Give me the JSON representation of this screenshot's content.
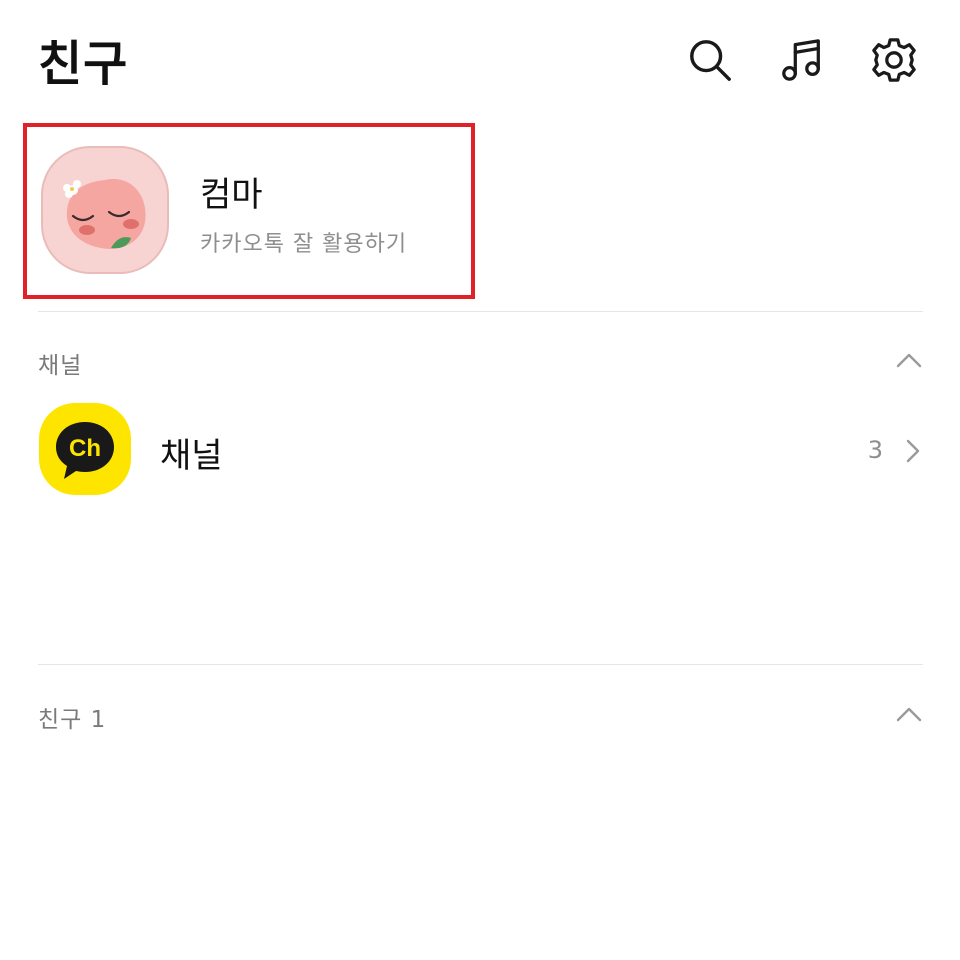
{
  "header": {
    "title": "친구",
    "icons": [
      "search-icon",
      "music-icon",
      "gear-icon"
    ]
  },
  "my_profile": {
    "name": "컴마",
    "status": "카카오톡 잘 활용하기",
    "highlight_color": "#e02128"
  },
  "channel_section": {
    "label": "채널",
    "row_label": "채널",
    "count": "3",
    "channel_icon_text": "Ch",
    "channel_icon_color": "#fee500"
  },
  "friends_section": {
    "label": "친구 1"
  }
}
